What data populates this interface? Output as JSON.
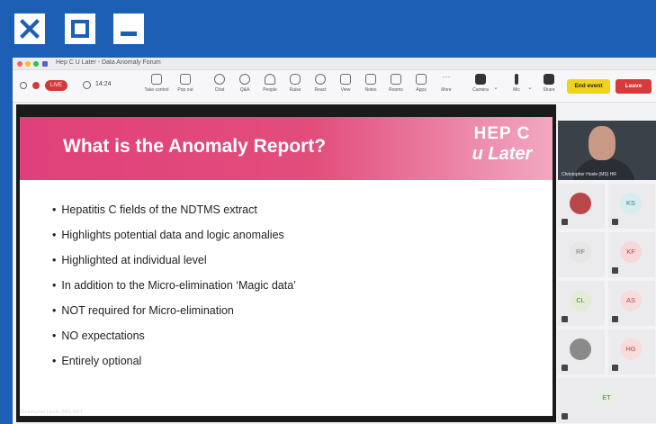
{
  "window_controls": {
    "close_icon": "close-icon",
    "maximize_icon": "maximize-icon",
    "minimize_icon": "minimize-icon"
  },
  "titlebar": {
    "title": "Hep C U Later - Data Anomaly Forum"
  },
  "toolbar": {
    "rec_label": "LIVE",
    "timer": "14:24",
    "items": [
      "Take control",
      "Pop out",
      "Chat",
      "Q&A",
      "People",
      "Raise",
      "React",
      "View",
      "Notes",
      "Rooms",
      "Apps",
      "More",
      "Camera",
      "Mic",
      "Share"
    ],
    "end_event_label": "End event",
    "leave_label": "Leave"
  },
  "slide": {
    "title": "What is the Anomaly Report?",
    "logo_line1": "HEP C",
    "logo_line2": "u Later",
    "bullets": [
      "Hepatitis C fields of the NDTMS extract",
      "Highlights potential data and logic anomalies",
      "Highlighted at individual level",
      "In addition to the Micro-elimination ‘Magic data’",
      "NOT required for Micro-elimination",
      "NO expectations",
      "Entirely optional"
    ],
    "presenter_strip": "Christopher Hosle (MS) MFT"
  },
  "participants": {
    "presenter_name": "Christopher Hosle (MS) HR",
    "tiles": [
      "",
      "KS",
      "RF",
      "KF",
      "CL",
      "AS",
      "",
      "HG",
      "ET"
    ]
  },
  "colors": {
    "outer_blue": "#1d5fb4",
    "banner_pink": "#e0407a",
    "end_event_yellow": "#f1d21c",
    "leave_red": "#d63a3a"
  }
}
